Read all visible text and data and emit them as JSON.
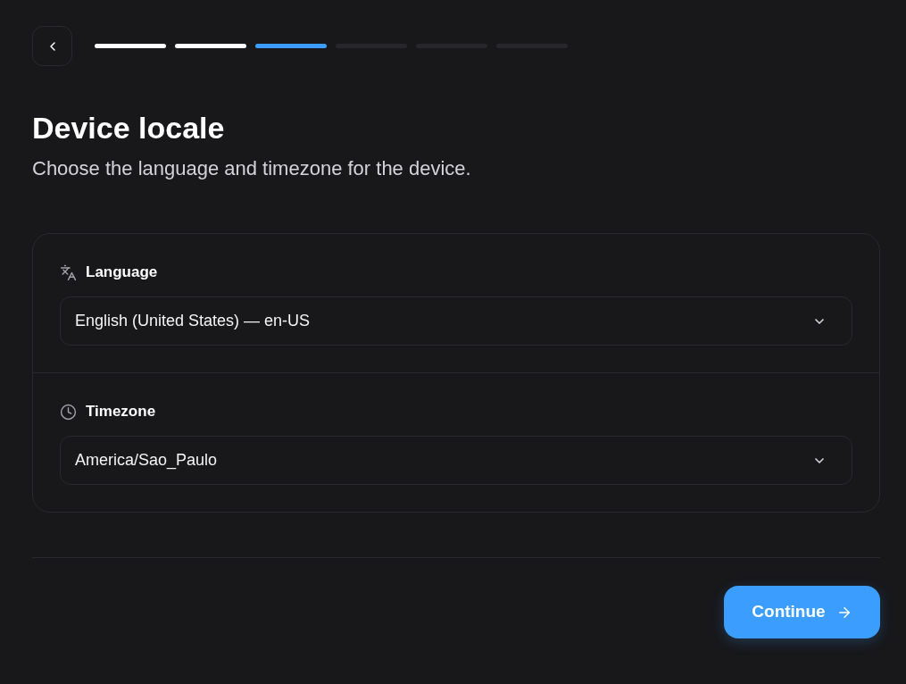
{
  "progress": {
    "steps": [
      {
        "complete": true,
        "selected": false
      },
      {
        "complete": true,
        "selected": false
      },
      {
        "complete": false,
        "selected": true
      },
      {
        "complete": false,
        "selected": false
      },
      {
        "complete": false,
        "selected": false
      },
      {
        "complete": false,
        "selected": false
      }
    ]
  },
  "title": "Device locale",
  "subtitle": "Choose the language and timezone for the device.",
  "settings": [
    {
      "kind": "language",
      "label": "Language",
      "value": "English (United States) — en-US"
    },
    {
      "kind": "timezone",
      "label": "Timezone",
      "value": "America/Sao_Paulo"
    }
  ],
  "primary_button": {
    "label": "Continue"
  }
}
